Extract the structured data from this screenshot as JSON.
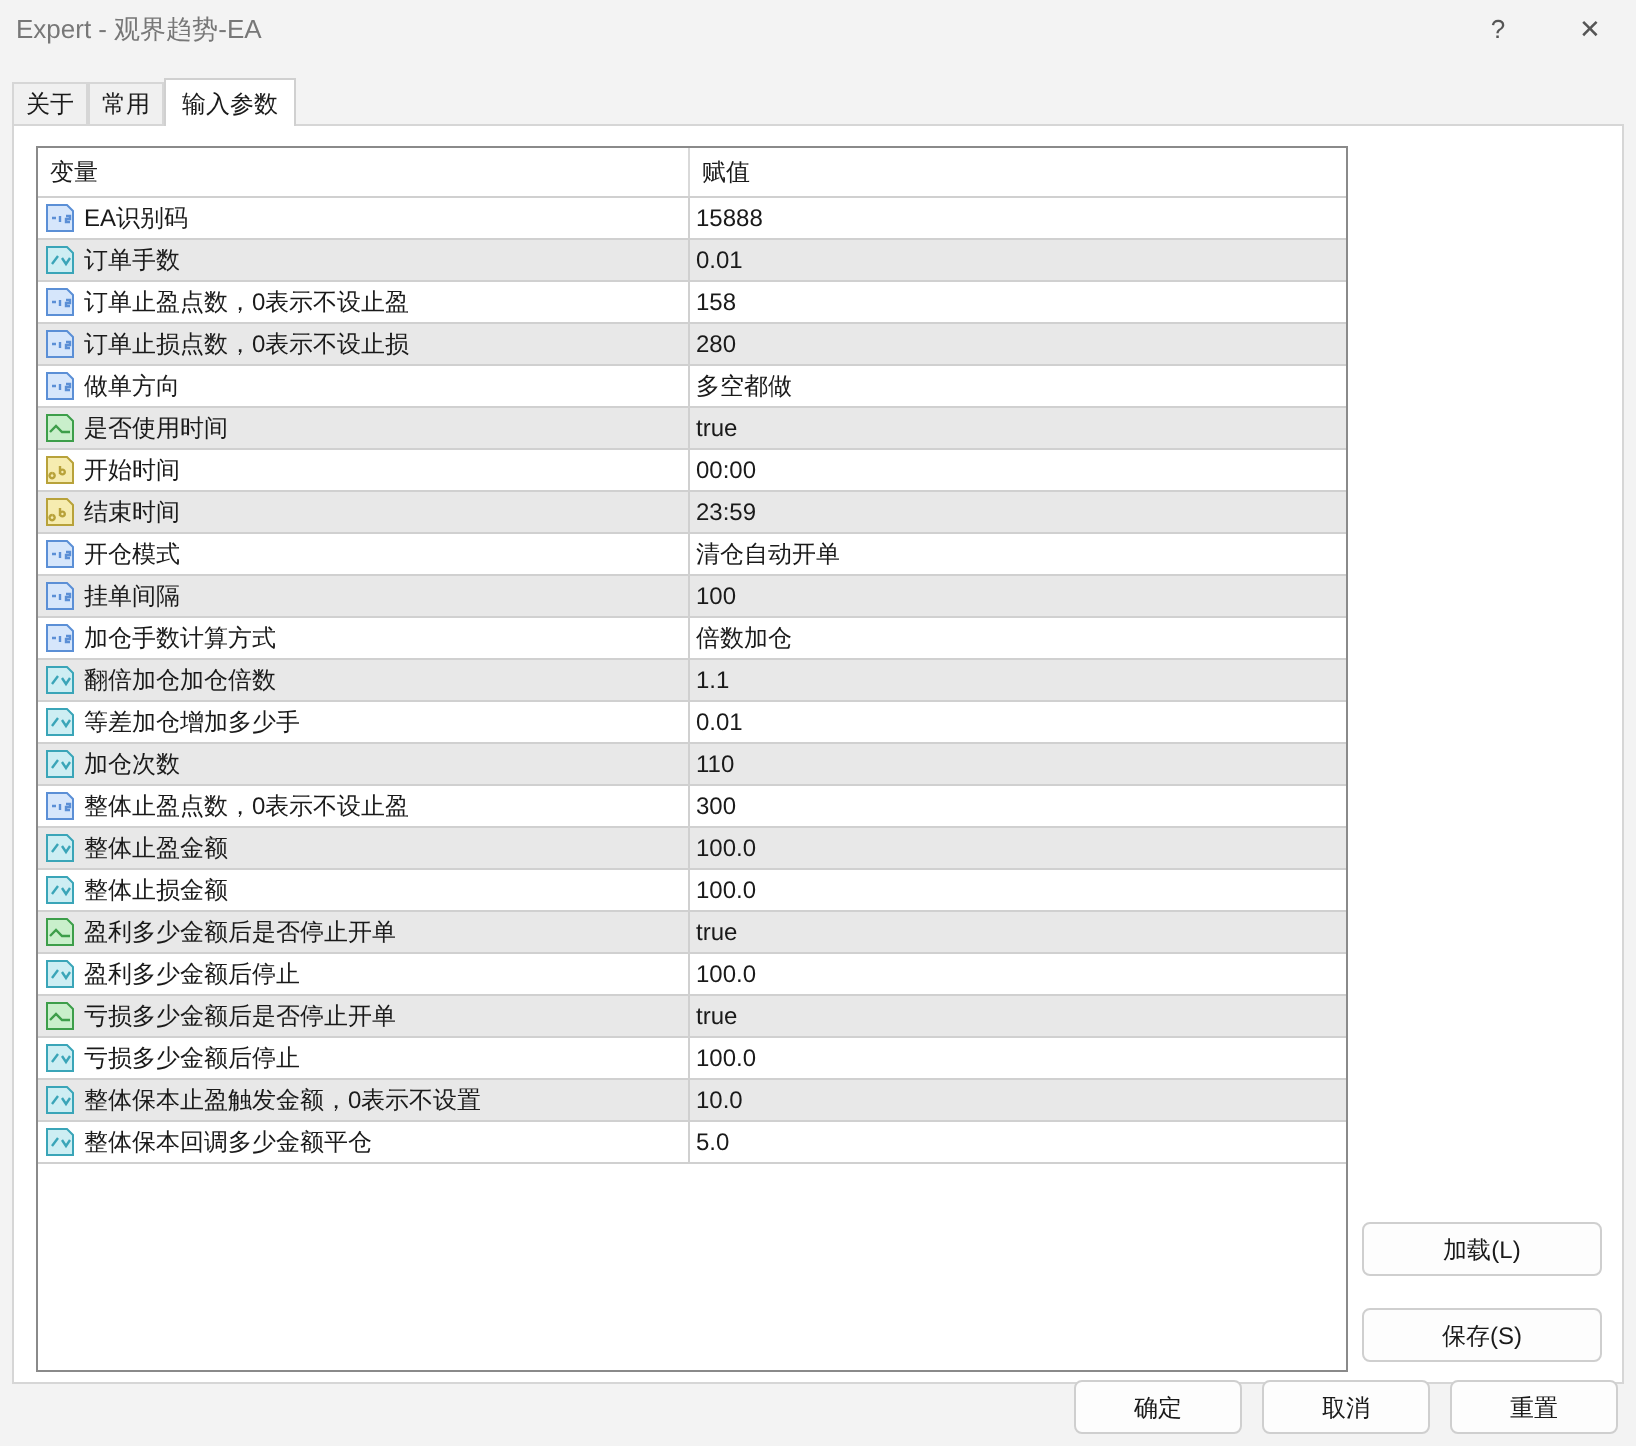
{
  "window": {
    "title": "Expert - 观界趋势-EA",
    "help": "?",
    "close": "✕"
  },
  "tabs": [
    {
      "label": "关于",
      "selected": false
    },
    {
      "label": "常用",
      "selected": false
    },
    {
      "label": "输入参数",
      "selected": true
    }
  ],
  "table": {
    "columns": [
      "变量",
      "赋值"
    ],
    "rows": [
      {
        "kind": "int",
        "name": "EA识别码",
        "value": "15888"
      },
      {
        "kind": "double",
        "name": "订单手数",
        "value": "0.01"
      },
      {
        "kind": "int",
        "name": "订单止盈点数，0表示不设止盈",
        "value": "158"
      },
      {
        "kind": "int",
        "name": "订单止损点数，0表示不设止损",
        "value": "280"
      },
      {
        "kind": "int",
        "name": "做单方向",
        "value": "多空都做"
      },
      {
        "kind": "bool",
        "name": "是否使用时间",
        "value": "true"
      },
      {
        "kind": "string",
        "name": "开始时间",
        "value": "00:00"
      },
      {
        "kind": "string",
        "name": "结束时间",
        "value": "23:59"
      },
      {
        "kind": "int",
        "name": "开仓模式",
        "value": "清仓自动开单"
      },
      {
        "kind": "int",
        "name": "挂单间隔",
        "value": "100"
      },
      {
        "kind": "int",
        "name": "加仓手数计算方式",
        "value": "倍数加仓"
      },
      {
        "kind": "double",
        "name": "翻倍加仓加仓倍数",
        "value": "1.1"
      },
      {
        "kind": "double",
        "name": "等差加仓增加多少手",
        "value": "0.01"
      },
      {
        "kind": "double",
        "name": "加仓次数",
        "value": "110"
      },
      {
        "kind": "int",
        "name": "整体止盈点数，0表示不设止盈",
        "value": "300"
      },
      {
        "kind": "double",
        "name": "整体止盈金额",
        "value": "100.0"
      },
      {
        "kind": "double",
        "name": "整体止损金额",
        "value": "100.0"
      },
      {
        "kind": "bool",
        "name": "盈利多少金额后是否停止开单",
        "value": "true"
      },
      {
        "kind": "double",
        "name": "盈利多少金额后停止",
        "value": "100.0"
      },
      {
        "kind": "bool",
        "name": "亏损多少金额后是否停止开单",
        "value": "true"
      },
      {
        "kind": "double",
        "name": "亏损多少金额后停止",
        "value": "100.0"
      },
      {
        "kind": "double",
        "name": "整体保本止盈触发金额，0表示不设置",
        "value": "10.0"
      },
      {
        "kind": "double",
        "name": "整体保本回调多少金额平仓",
        "value": "5.0"
      }
    ]
  },
  "side_buttons": [
    "加载(L)",
    "保存(S)"
  ],
  "buttons": [
    "确定",
    "取消",
    "重置"
  ]
}
